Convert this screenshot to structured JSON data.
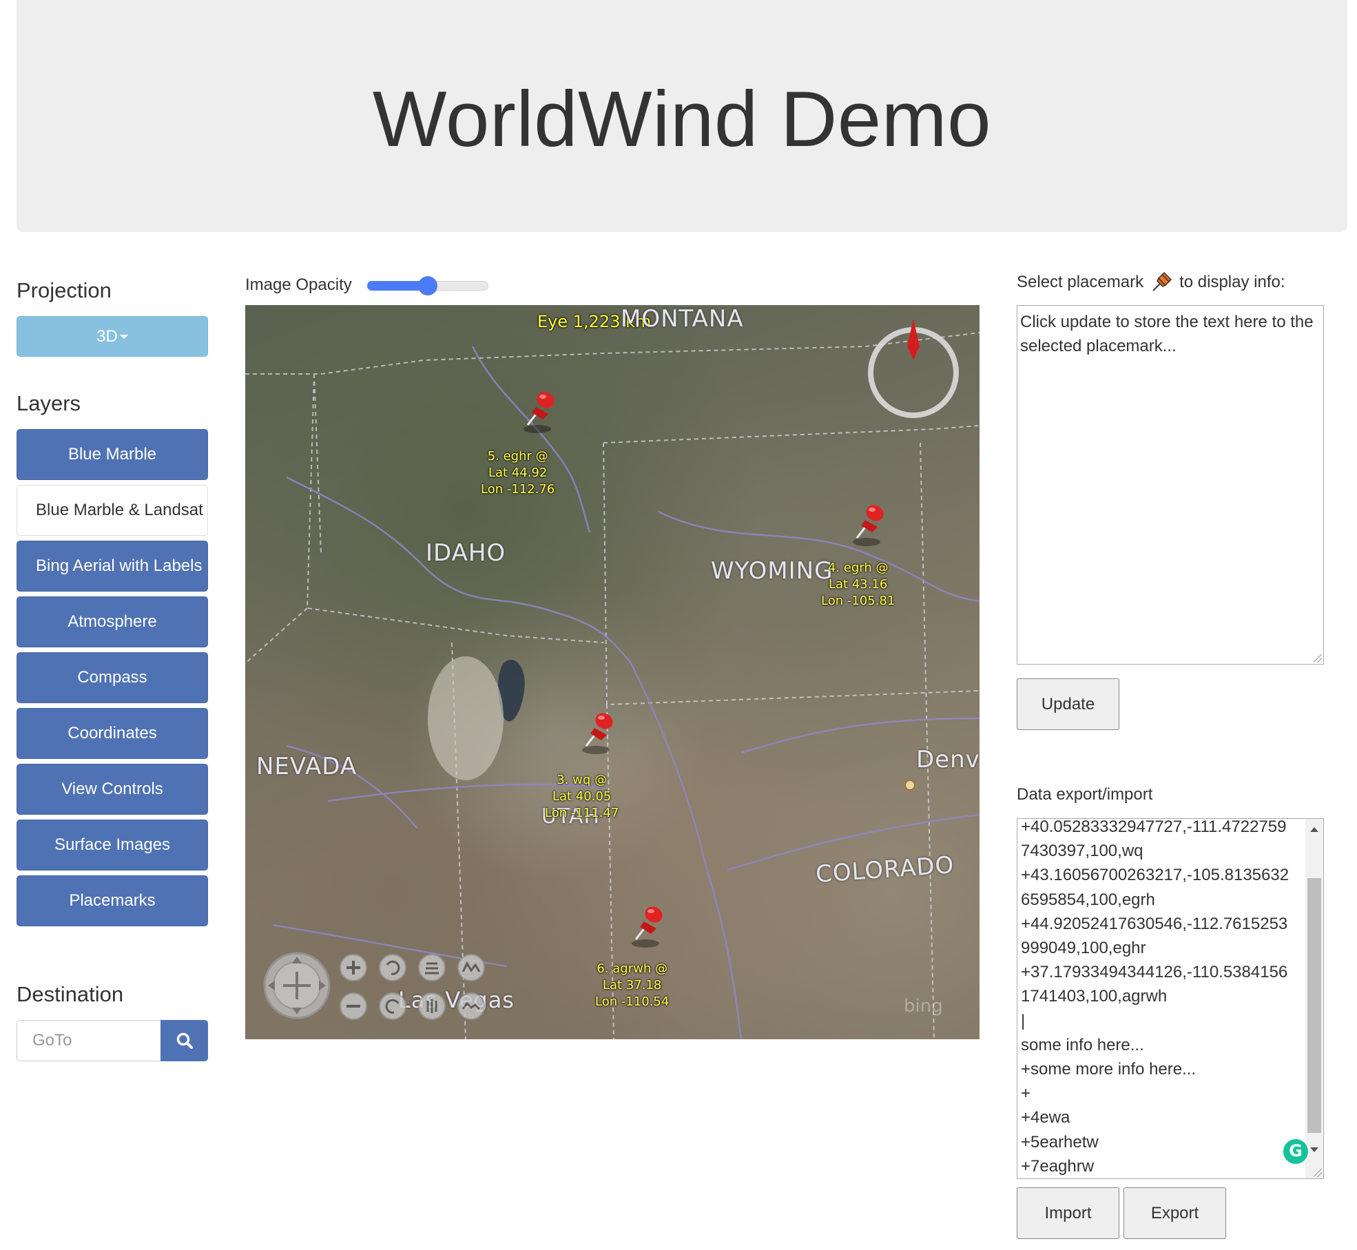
{
  "header": {
    "title": "WorldWind Demo"
  },
  "sidebar": {
    "projection_title": "Projection",
    "projection_value": "3D",
    "layers_title": "Layers",
    "layers": [
      {
        "label": "Blue Marble",
        "active": true
      },
      {
        "label": "Blue Marble & Landsat",
        "active": false
      },
      {
        "label": "Bing Aerial with Labels",
        "active": true
      },
      {
        "label": "Atmosphere",
        "active": true
      },
      {
        "label": "Compass",
        "active": true
      },
      {
        "label": "Coordinates",
        "active": true
      },
      {
        "label": "View Controls",
        "active": true
      },
      {
        "label": "Surface Images",
        "active": true
      },
      {
        "label": "Placemarks",
        "active": true
      }
    ],
    "destination_title": "Destination",
    "goto_placeholder": "GoTo"
  },
  "center": {
    "opacity_label": "Image Opacity",
    "opacity_value": 0.5
  },
  "map": {
    "eye_label": "Eye  1,223 km",
    "states": [
      "MONTANA",
      "IDAHO",
      "WYOMING",
      "NEVADA",
      "UTAH",
      "COLORADO"
    ],
    "cities": [
      "Denv",
      "Las Vegas"
    ],
    "attribution": "bing",
    "placemarks": [
      {
        "line1": "5. eghr @",
        "line2": "Lat 44.92",
        "line3": "Lon -112.76"
      },
      {
        "line1": "4. egrh @",
        "line2": "Lat 43.16",
        "line3": "Lon -105.81"
      },
      {
        "line1": "3. wq @",
        "line2": "Lat 40.05",
        "line3": "Lon -111.47"
      },
      {
        "line1": "6. agrwh @",
        "line2": "Lat 37.18",
        "line3": "Lon -110.54"
      }
    ]
  },
  "right": {
    "placemark_label_before": "Select placemark",
    "placemark_label_after": "to display info:",
    "info_text": "Click update to store the text here to the selected placemark...",
    "update_button": "Update",
    "export_label": "Data export/import",
    "data_lines": [
      "+40.05283332947727,-111.4722759",
      "7430397,100,wq",
      "+43.16056700263217,-105.8135632",
      "6595854,100,egrh",
      "+44.92052417630546,-112.7615253",
      "999049,100,eghr",
      "+37.17933494344126,-110.5384156",
      "1741403,100,agrwh",
      "|",
      "some info here...",
      "+some more info here...",
      "+",
      "+4ewa",
      "+5earhetw",
      "+7eaghrw"
    ],
    "import_button": "Import",
    "export_button": "Export"
  },
  "colors": {
    "layer_active": "#4f72b4",
    "projection_button": "#88c1e0",
    "slider": "#4c7cf3",
    "placemark_label": "#ffff44",
    "pin": "#d82020"
  }
}
